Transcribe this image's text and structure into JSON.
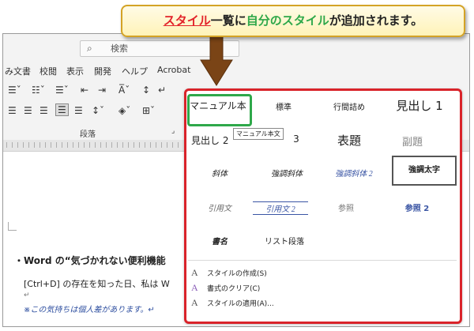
{
  "callout": {
    "part1": "スタイル",
    "part2": "一覧に",
    "part3": "自分のスタイル",
    "part4": "が追加されます。"
  },
  "word": {
    "search_placeholder": "検索",
    "tabs": [
      "み文書",
      "校閲",
      "表示",
      "開発",
      "ヘルプ",
      "Acrobat"
    ],
    "paragraph_group_label": "段落",
    "document": {
      "heading": "・Word の“気づかれない便利機能",
      "line1": "[Ctrl+D] の存在を知った日、私は W",
      "return_mark": "↵",
      "note": "※この気持ちは個人差があります。↵"
    }
  },
  "styles_gallery": {
    "row1": [
      "マニュアル本",
      "標準",
      "行間詰め",
      "見出し 1"
    ],
    "row2": [
      "見出し 2",
      "3",
      "表題",
      "副題"
    ],
    "tooltip": "マニュアル本文",
    "row3": [
      "斜体",
      "強調斜体",
      "強調斜体 2",
      "強調太字"
    ],
    "row4": [
      "引用文",
      "引用文 2",
      "参照",
      "参照 2"
    ],
    "row5": [
      "書名",
      "リスト段落"
    ],
    "menu": [
      {
        "icon": "A",
        "label": "スタイルの作成(S)"
      },
      {
        "icon": "A",
        "label": "書式のクリア(C)"
      },
      {
        "icon": "A",
        "label": "スタイルの適用(A)..."
      }
    ]
  },
  "colors": {
    "highlight_red": "#d9232a",
    "highlight_green": "#2ea84a",
    "arrow_brown": "#7a4416",
    "callout_border": "#d4a325"
  }
}
